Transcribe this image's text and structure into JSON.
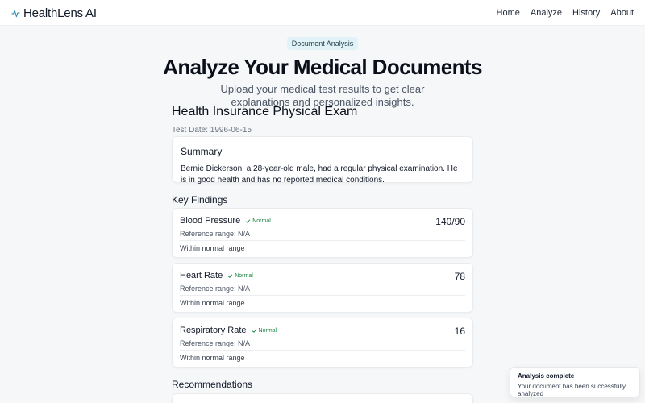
{
  "header": {
    "brand": "HealthLens AI",
    "nav": [
      "Home",
      "Analyze",
      "History",
      "About"
    ]
  },
  "hero": {
    "pill": "Document Analysis",
    "title": "Analyze Your Medical Documents",
    "subtitle": "Upload your medical test results to get clear explanations and personalized insights."
  },
  "exam": {
    "title": "Health Insurance Physical Exam",
    "date": "Test Date: 1996-06-15"
  },
  "summary": {
    "heading": "Summary",
    "text": "Bernie Dickerson, a 28-year-old male, had a regular physical examination. He is in good health and has no reported medical conditions."
  },
  "key_findings": {
    "heading": "Key Findings",
    "items": [
      {
        "name": "Blood Pressure",
        "status": "Normal",
        "value": "140/90",
        "reference": "Reference range: N/A",
        "note": "Within normal range"
      },
      {
        "name": "Heart Rate",
        "status": "Normal",
        "value": "78",
        "reference": "Reference range: N/A",
        "note": "Within normal range"
      },
      {
        "name": "Respiratory Rate",
        "status": "Normal",
        "value": "16",
        "reference": "Reference range: N/A",
        "note": "Within normal range"
      }
    ]
  },
  "recommendations": {
    "heading": "Recommendations"
  },
  "toast": {
    "title": "Analysis complete",
    "message": "Your document has been successfully analyzed"
  },
  "colors": {
    "brand_icon": "#2d8fb0",
    "normal_badge": "#15803d",
    "pill_bg": "#e1f3f7",
    "page_bg": "#f5f7f9"
  },
  "icons": {
    "brand": "heartbeat-pulse-icon",
    "status": "check-icon"
  }
}
